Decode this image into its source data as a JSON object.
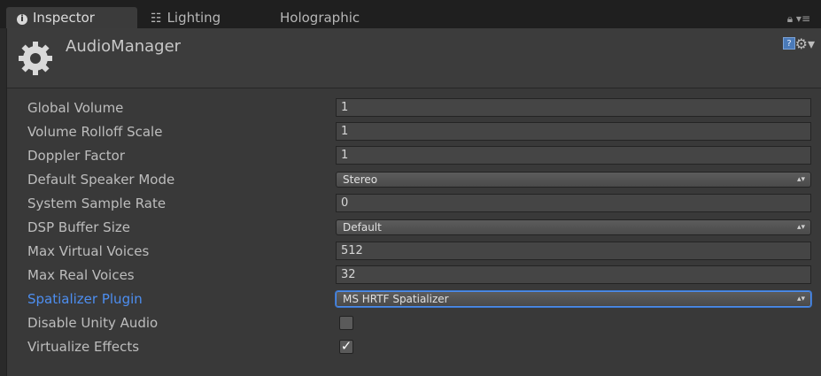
{
  "tabs": [
    {
      "label": "Inspector",
      "icon": "info-icon",
      "active": true
    },
    {
      "label": "Lighting",
      "icon": "lighting-icon",
      "active": false
    },
    {
      "label": "Holographic",
      "active": false
    }
  ],
  "tab_tools": {
    "lock_icon": "lock-icon",
    "menu_icon": "tab-menu-icon"
  },
  "header": {
    "title": "AudioManager",
    "icon": "gear-icon",
    "help_icon": "help-icon",
    "settings_icon": "settings-icon"
  },
  "fields": [
    {
      "label": "Global Volume",
      "type": "text",
      "value": "1"
    },
    {
      "label": "Volume Rolloff Scale",
      "type": "text",
      "value": "1"
    },
    {
      "label": "Doppler Factor",
      "type": "text",
      "value": "1"
    },
    {
      "label": "Default Speaker Mode",
      "type": "dropdown",
      "value": "Stereo"
    },
    {
      "label": "System Sample Rate",
      "type": "text",
      "value": "0"
    },
    {
      "label": "DSP Buffer Size",
      "type": "dropdown",
      "value": "Default"
    },
    {
      "label": "Max Virtual Voices",
      "type": "text",
      "value": "512"
    },
    {
      "label": "Max Real Voices",
      "type": "text",
      "value": "32"
    },
    {
      "label": "Spatializer Plugin",
      "type": "dropdown",
      "value": "MS HRTF Spatializer",
      "focused": true
    },
    {
      "label": "Disable Unity Audio",
      "type": "checkbox",
      "checked": false
    },
    {
      "label": "Virtualize Effects",
      "type": "checkbox",
      "checked": true
    }
  ],
  "colors": {
    "highlight_label": "#4d8ef0",
    "panel_bg": "#393939",
    "tabbar_bg": "#1f1f1f"
  }
}
